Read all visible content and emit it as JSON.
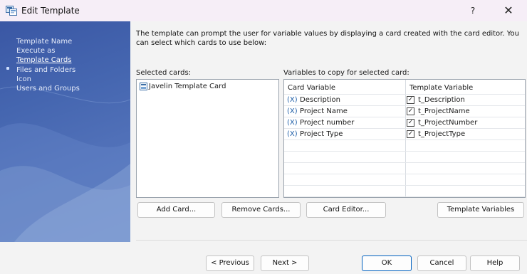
{
  "window": {
    "title": "Edit Template",
    "help_label": "?",
    "close_label": "✕"
  },
  "nav": {
    "items": [
      {
        "label": "Template Name"
      },
      {
        "label": "Execute as"
      },
      {
        "label": "Template Cards"
      },
      {
        "label": "Files and Folders"
      },
      {
        "label": "Icon"
      },
      {
        "label": "Users and Groups"
      }
    ],
    "active_index": 2
  },
  "main": {
    "description": "The template can prompt the user for variable values by displaying a card created with the card editor. You can select which cards to use below:",
    "selected_cards_label": "Selected cards:",
    "variables_label": "Variables to copy for selected card:",
    "cards": [
      {
        "label": "Javelin Template Card"
      }
    ],
    "table": {
      "headers": [
        "Card Variable",
        "Template Variable"
      ],
      "rows": [
        {
          "x": "(X)",
          "card_variable": "Description",
          "checked": true,
          "template_variable": "t_Description"
        },
        {
          "x": "(X)",
          "card_variable": "Project Name",
          "checked": true,
          "template_variable": "t_ProjectName"
        },
        {
          "x": "(X)",
          "card_variable": "Project number",
          "checked": true,
          "template_variable": "t_ProjectNumber"
        },
        {
          "x": "(X)",
          "card_variable": "Project Type",
          "checked": true,
          "template_variable": "t_ProjectType"
        }
      ]
    },
    "buttons": {
      "add_card": "Add Card...",
      "remove_cards": "Remove Cards...",
      "card_editor": "Card Editor...",
      "template_variables": "Template Variables"
    }
  },
  "footer": {
    "previous": "< Previous",
    "next": "Next >",
    "ok": "OK",
    "cancel": "Cancel",
    "help": "Help"
  },
  "check_glyph": "✓"
}
